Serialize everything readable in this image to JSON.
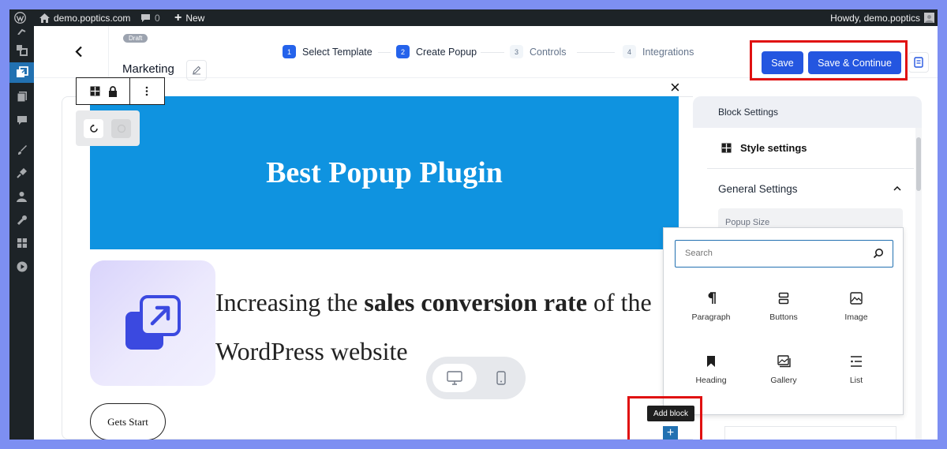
{
  "admin_bar": {
    "site_name": "demo.poptics.com",
    "comments_count": "0",
    "new_label": "New",
    "howdy": "Howdy, demo.poptics"
  },
  "editor_header": {
    "status_badge": "Draft",
    "popup_title": "Marketing",
    "steps": [
      {
        "num": "1",
        "label": "Select Template",
        "state": "complete"
      },
      {
        "num": "2",
        "label": "Create Popup",
        "state": "current"
      },
      {
        "num": "3",
        "label": "Controls",
        "state": "upcoming"
      },
      {
        "num": "4",
        "label": "Integrations",
        "state": "upcoming"
      }
    ],
    "save_label": "Save",
    "save_continue_label": "Save & Continue"
  },
  "popup": {
    "banner_title": "Best Popup Plugin",
    "body_text_pre": "Increasing the ",
    "body_text_bold": "sales conversion rate",
    "body_text_post": " of the WordPress website",
    "cta_label": "Gets Start",
    "close_symbol": "×"
  },
  "settings_panel": {
    "header": "Block Settings",
    "style_settings": "Style settings",
    "general_settings": "General Settings",
    "popup_size_label": "Popup Size"
  },
  "block_inserter": {
    "search_placeholder": "Search",
    "blocks": [
      {
        "label": "Paragraph",
        "icon": "paragraph-icon"
      },
      {
        "label": "Buttons",
        "icon": "buttons-icon"
      },
      {
        "label": "Image",
        "icon": "image-icon"
      },
      {
        "label": "Heading",
        "icon": "heading-bookmark-icon"
      },
      {
        "label": "Gallery",
        "icon": "gallery-icon"
      },
      {
        "label": "List",
        "icon": "list-icon"
      }
    ]
  },
  "add_block": {
    "tooltip": "Add block",
    "symbol": "+"
  },
  "colors": {
    "accent_blue": "#2456e0",
    "banner_blue": "#0f93e0",
    "highlight_red": "#e01111",
    "wp_dark": "#1d2327",
    "wp_active": "#2271b1"
  }
}
